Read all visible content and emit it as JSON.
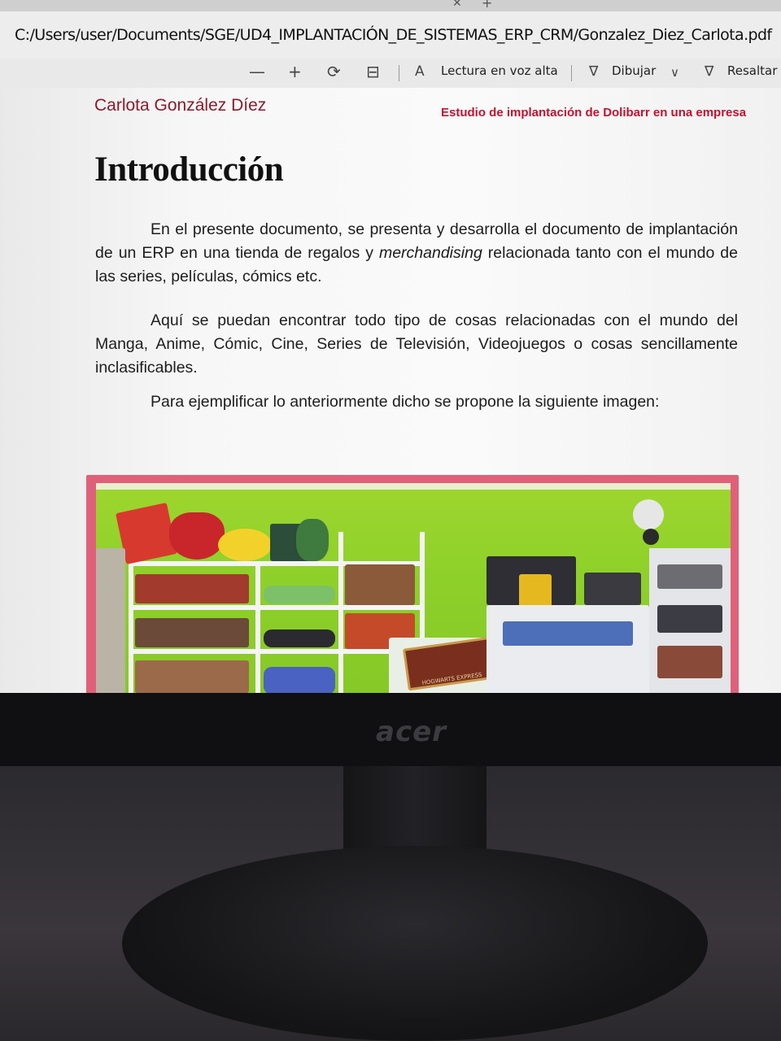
{
  "browser": {
    "tab_close_glyph": "✕",
    "tab_new_glyph": "+",
    "address": "C:/Users/user/Documents/SGE/UD4_IMPLANTACIÓN_DE_SISTEMAS_ERP_CRM/Gonzalez_Diez_Carlota.pdf"
  },
  "toolbar": {
    "zoom_out": "—",
    "zoom_in": "+",
    "read_aloud_label": "Lectura en voz alta",
    "draw_label": "Dibujar",
    "highlight_label": "Resaltar",
    "icons": [
      "minus-icon",
      "plus-icon",
      "rotate-icon",
      "fit-page-icon",
      "read-aloud-icon",
      "draw-icon",
      "chevron-down-icon",
      "highlight-icon"
    ]
  },
  "document": {
    "header_author": "Carlota González Díez",
    "header_title": "Estudio de implantación de Dolibarr en una empresa",
    "heading": "Introducción",
    "paragraph1_a": "En el presente documento, se presenta y desarrolla el documento de implantación de un ERP en una tienda  de regalos y ",
    "paragraph1_em": "merchandising",
    "paragraph1_b": " relacionada tanto con el mundo de las series, películas, cómics etc.",
    "paragraph2": "Aquí se puedan encontrar todo tipo de cosas relacionadas con el mundo del Manga, Anime, Cómic, Cine, Series de Televisión, Videojuegos o cosas sencillamente inclasificables.",
    "paragraph3": "Para ejemplificar lo anteriormente dicho se propone la siguiente imagen:",
    "image_sign": "HOGWARTS EXPRESS"
  },
  "monitor": {
    "brand": "acer"
  },
  "colors": {
    "header_author": "#8b1b2a",
    "header_title": "#c41230",
    "photo_frame": "#e0607a",
    "store_wall": "#8fd12a"
  }
}
